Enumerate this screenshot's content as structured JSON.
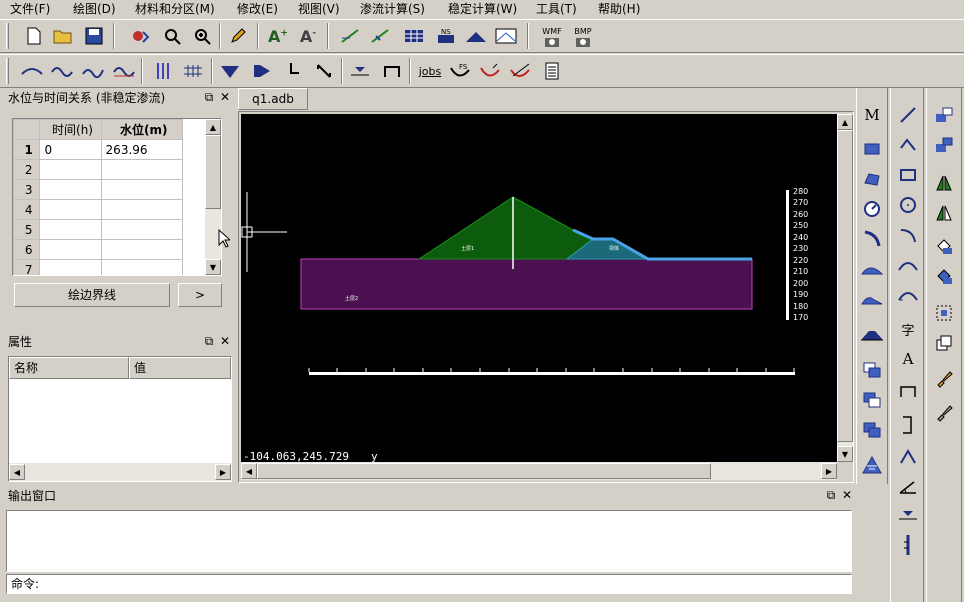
{
  "menu": [
    {
      "label": "文件(F)"
    },
    {
      "label": "绘图(D)"
    },
    {
      "label": "材料和分区(M)"
    },
    {
      "label": "修改(E)"
    },
    {
      "label": "视图(V)"
    },
    {
      "label": "渗流计算(S)"
    },
    {
      "label": "稳定计算(W)"
    },
    {
      "label": "工具(T)"
    },
    {
      "label": "帮助(H)"
    }
  ],
  "toolbar1": {
    "wmf_label": "WMF",
    "bmp_label": "BMP"
  },
  "toolbar2": {
    "jobs_label": "jobs",
    "fs_label": "FS"
  },
  "water_panel": {
    "title": "水位与时间关系 (非稳定渗流)",
    "col_time": "时间(h)",
    "col_level": "水位(m)",
    "rows": [
      {
        "n": "1",
        "time": "0",
        "level": "263.96"
      },
      {
        "n": "2",
        "time": "",
        "level": ""
      },
      {
        "n": "3",
        "time": "",
        "level": ""
      },
      {
        "n": "4",
        "time": "",
        "level": ""
      },
      {
        "n": "5",
        "time": "",
        "level": ""
      },
      {
        "n": "6",
        "time": "",
        "level": ""
      },
      {
        "n": "7",
        "time": "",
        "level": ""
      }
    ],
    "draw_button": "绘边界线",
    "next_button": ">"
  },
  "props_panel": {
    "title": "属性",
    "col_name": "名称",
    "col_value": "值"
  },
  "doc_tab": "q1.adb",
  "canvas": {
    "coord_readout": "-104.063,245.729",
    "axis_letter": "y",
    "material_labels": [
      "土层1",
      "坝体",
      "土层2"
    ],
    "scale_labels": [
      "280",
      "270",
      "260",
      "250",
      "240",
      "230",
      "220",
      "210",
      "200",
      "190",
      "180",
      "170"
    ],
    "colors": {
      "background": "#000000",
      "upper_zone": "#0d5c0d",
      "drain": "#1a6a7a",
      "foundation": "#4a1050",
      "water": "#4aa3e6"
    }
  },
  "output_panel": {
    "title": "输出窗口",
    "command_label": "命令:"
  },
  "right_toolbar_icons": [
    "M-icon",
    "rect-icon",
    "polygon-icon",
    "circle-icon",
    "arc-icon",
    "slope-icon",
    "slope2-icon",
    "dam-icon",
    "layer1-icon",
    "layer2-icon",
    "layer3-icon",
    "grid-icon"
  ]
}
